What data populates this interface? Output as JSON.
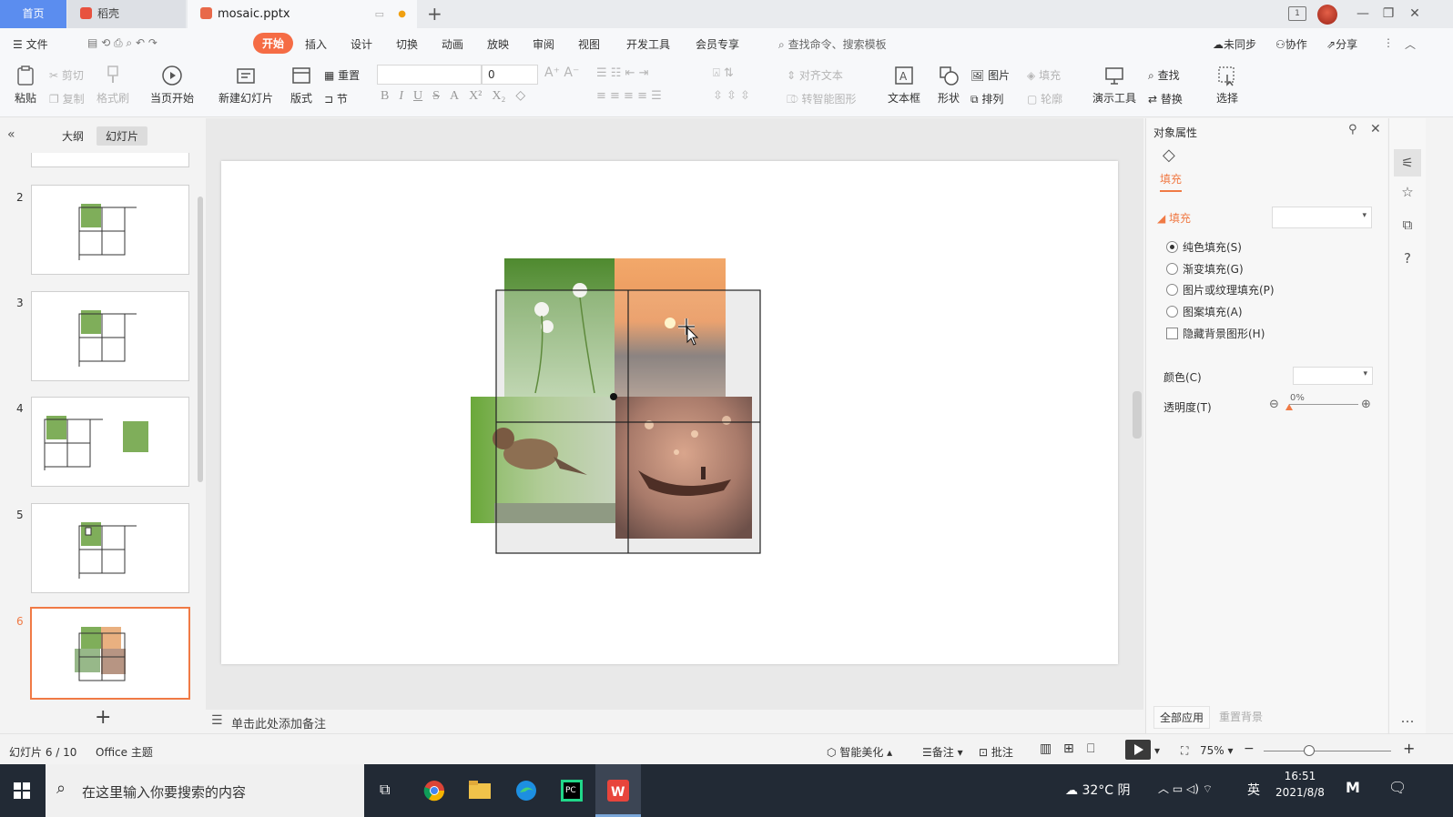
{
  "tabs": {
    "home": "首页",
    "daoke": "稻壳",
    "document": "mosaic.pptx"
  },
  "window": {
    "page_indicator": "1"
  },
  "menu": {
    "file": "文件",
    "items": [
      "开始",
      "插入",
      "设计",
      "切换",
      "动画",
      "放映",
      "审阅",
      "视图",
      "开发工具",
      "会员专享"
    ],
    "active": "开始",
    "search_placeholder": "查找命令、搜索模板",
    "sync": "未同步",
    "collab": "协作",
    "share": "分享"
  },
  "ribbon": {
    "paste": "粘贴",
    "cut": "剪切",
    "copy": "复制",
    "format_painter": "格式刷",
    "from_current": "当页开始",
    "new_slide": "新建幻灯片",
    "layout": "版式",
    "reset": "重置",
    "section": "节",
    "font_size": "0",
    "align_text": "对齐文本",
    "to_smartart": "转智能图形",
    "textbox": "文本框",
    "shape": "形状",
    "picture": "图片",
    "arrange": "排列",
    "fill": "填充",
    "outline": "轮廓",
    "present_tools": "演示工具",
    "find": "查找",
    "replace": "替换",
    "select": "选择"
  },
  "slides_panel": {
    "tab_outline": "大纲",
    "tab_slides": "幻灯片",
    "thumbnails": [
      {
        "number": "2"
      },
      {
        "number": "3"
      },
      {
        "number": "4"
      },
      {
        "number": "5"
      },
      {
        "number": "6",
        "selected": true
      }
    ]
  },
  "notes_placeholder": "单击此处添加备注",
  "properties": {
    "title": "对象属性",
    "tab": "填充",
    "section": "填充",
    "options": [
      {
        "label": "纯色填充(S)",
        "type": "radio",
        "checked": true
      },
      {
        "label": "渐变填充(G)",
        "type": "radio",
        "checked": false
      },
      {
        "label": "图片或纹理填充(P)",
        "type": "radio",
        "checked": false
      },
      {
        "label": "图案填充(A)",
        "type": "radio",
        "checked": false
      },
      {
        "label": "隐藏背景图形(H)",
        "type": "checkbox",
        "checked": false
      }
    ],
    "color_label": "颜色(C)",
    "transparency_label": "透明度(T)",
    "transparency_value": "0%",
    "apply_all": "全部应用",
    "reset_bg": "重置背景"
  },
  "status": {
    "slide_info": "幻灯片 6 / 10",
    "theme": "Office 主题",
    "beautify": "智能美化",
    "notes": "备注",
    "comment": "批注",
    "zoom": "75%"
  },
  "taskbar": {
    "search_placeholder": "在这里输入你要搜索的内容",
    "weather": "32°C 阴",
    "ime": "英",
    "time": "16:51",
    "date": "2021/8/8"
  },
  "colors": {
    "accent": "#f07a45",
    "home_tab": "#5b8def",
    "taskbar": "#222a35"
  }
}
